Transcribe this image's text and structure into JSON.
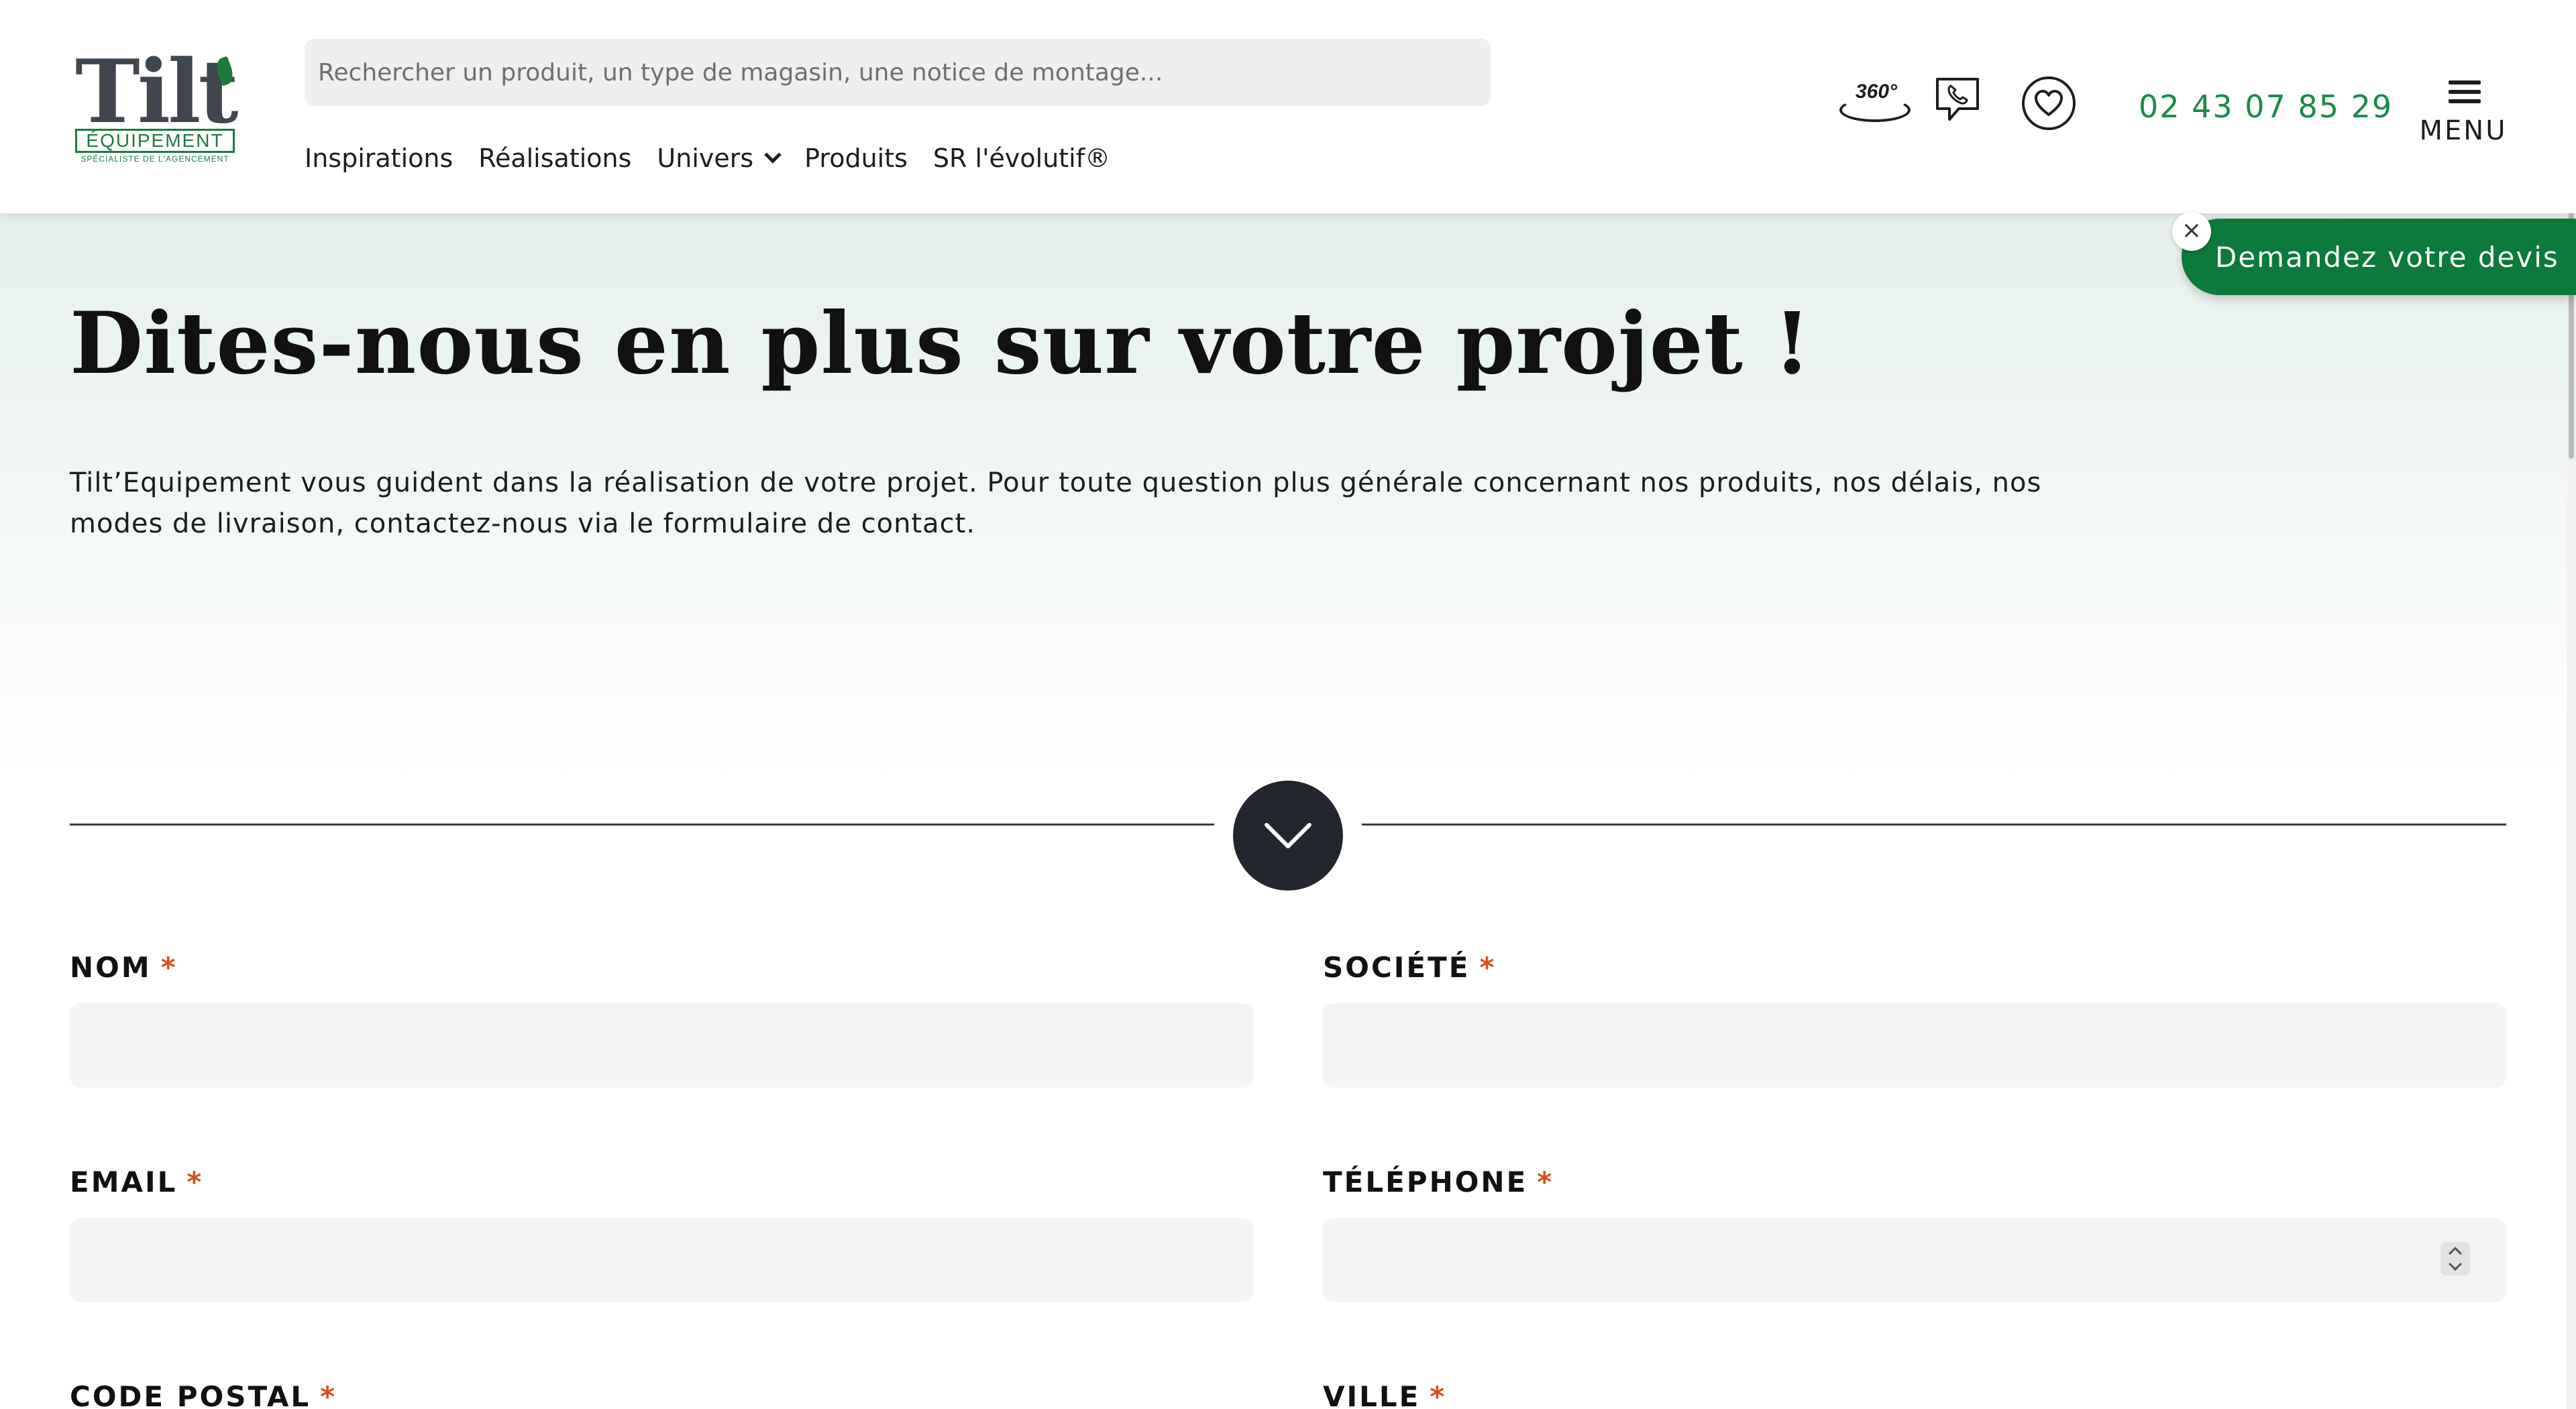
{
  "logo": {
    "main": "Tilt",
    "brand": "ÉQUIPEMENT",
    "tagline": "SPÉCIALISTE DE L'AGENCEMENT"
  },
  "search": {
    "placeholder": "Rechercher un produit, un type de magasin, une notice de montage..."
  },
  "nav": {
    "items": [
      {
        "label": "Inspirations"
      },
      {
        "label": "Réalisations"
      },
      {
        "label": "Univers"
      },
      {
        "label": "Produits"
      },
      {
        "label": "SR l'évolutif®"
      }
    ]
  },
  "header": {
    "tour_label": "360°",
    "phone": "02 43 07 85 29",
    "menu_label": "MENU"
  },
  "cta": {
    "devis_label": "Demandez votre devis",
    "close_label": "×"
  },
  "hero": {
    "title": "Dites-nous en plus sur votre projet !",
    "text": "Tilt’Equipement vous guident dans la réalisation de votre projet. Pour toute question plus générale concernant nos produits, nos délais, nos modes de livraison, contactez-nous via le formulaire de contact."
  },
  "form": {
    "required_mark": "*",
    "fields": {
      "nom": {
        "label": "NOM",
        "value": ""
      },
      "societe": {
        "label": "SOCIÉTÉ",
        "value": ""
      },
      "email": {
        "label": "EMAIL",
        "value": ""
      },
      "telephone": {
        "label": "TÉLÉPHONE",
        "value": ""
      },
      "code_postal": {
        "label": "CODE POSTAL"
      },
      "ville": {
        "label": "VILLE"
      }
    }
  },
  "colors": {
    "accent_green": "#0b7a3b",
    "phone_green": "#1b8a45",
    "required_orange": "#d6501c",
    "dark_button": "#23262d"
  }
}
